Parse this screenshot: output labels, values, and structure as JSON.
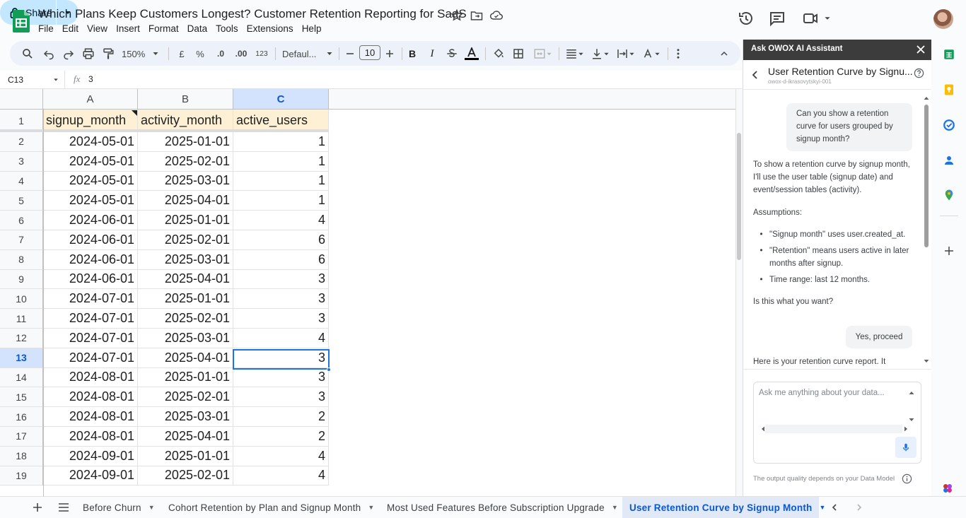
{
  "doc": {
    "title": "Which Plans Keep Customers Longest? Customer Retention Reporting for SaaS"
  },
  "menu": [
    "File",
    "Edit",
    "View",
    "Insert",
    "Format",
    "Data",
    "Tools",
    "Extensions",
    "Help"
  ],
  "share": {
    "label": "Share"
  },
  "toolbar": {
    "zoom": "150%",
    "currency": "£",
    "percent": "%",
    "decrease_decimals": ".0",
    "increase_decimals": ".00",
    "number_format": "123",
    "font": "Defaul...",
    "font_size": "10",
    "bold": "B",
    "italic": "I"
  },
  "formula_bar": {
    "cell_ref": "C13",
    "fx": "fx",
    "value": "3"
  },
  "grid": {
    "columns": [
      "A",
      "B",
      "C"
    ],
    "header_row": {
      "num": "1",
      "cells": [
        "signup_month",
        "activity_month",
        "active_users"
      ]
    },
    "rows": [
      {
        "num": "2",
        "cells": [
          "2024-05-01",
          "2025-01-01",
          "1"
        ]
      },
      {
        "num": "3",
        "cells": [
          "2024-05-01",
          "2025-02-01",
          "1"
        ]
      },
      {
        "num": "4",
        "cells": [
          "2024-05-01",
          "2025-03-01",
          "1"
        ]
      },
      {
        "num": "5",
        "cells": [
          "2024-05-01",
          "2025-04-01",
          "1"
        ]
      },
      {
        "num": "6",
        "cells": [
          "2024-06-01",
          "2025-01-01",
          "4"
        ]
      },
      {
        "num": "7",
        "cells": [
          "2024-06-01",
          "2025-02-01",
          "6"
        ]
      },
      {
        "num": "8",
        "cells": [
          "2024-06-01",
          "2025-03-01",
          "6"
        ]
      },
      {
        "num": "9",
        "cells": [
          "2024-06-01",
          "2025-04-01",
          "3"
        ]
      },
      {
        "num": "10",
        "cells": [
          "2024-07-01",
          "2025-01-01",
          "3"
        ]
      },
      {
        "num": "11",
        "cells": [
          "2024-07-01",
          "2025-02-01",
          "3"
        ]
      },
      {
        "num": "12",
        "cells": [
          "2024-07-01",
          "2025-03-01",
          "4"
        ]
      },
      {
        "num": "13",
        "cells": [
          "2024-07-01",
          "2025-04-01",
          "3"
        ]
      },
      {
        "num": "14",
        "cells": [
          "2024-08-01",
          "2025-01-01",
          "3"
        ]
      },
      {
        "num": "15",
        "cells": [
          "2024-08-01",
          "2025-02-01",
          "3"
        ]
      },
      {
        "num": "16",
        "cells": [
          "2024-08-01",
          "2025-03-01",
          "2"
        ]
      },
      {
        "num": "17",
        "cells": [
          "2024-08-01",
          "2025-04-01",
          "2"
        ]
      },
      {
        "num": "18",
        "cells": [
          "2024-09-01",
          "2025-01-01",
          "4"
        ]
      },
      {
        "num": "19",
        "cells": [
          "2024-09-01",
          "2025-02-01",
          "4"
        ]
      }
    ]
  },
  "assistant": {
    "panel_title": "Ask OWOX AI Assistant",
    "report_title": "User Retention Curve by Signu...",
    "report_subtitle": "owox-d-ikrasovytskyi-001",
    "user_message_1": "Can you show a retention curve for users grouped by signup month?",
    "reply_intro": "To show a retention curve by signup month, I'll use the user table (signup date) and event/session tables (activity).",
    "assumptions_heading": "Assumptions:",
    "assumptions": [
      "\"Signup month\" uses user.created_at.",
      "\"Retention\" means users active in later months after signup.",
      "Time range: last 12 months."
    ],
    "question": "Is this what you want?",
    "user_message_2": "Yes, proceed",
    "reply_partial": "Here is your retention curve report. It",
    "input_placeholder": "Ask me anything about your data...",
    "footer_note": "The output quality depends on your Data Model"
  },
  "tabs": [
    {
      "label": "Before Churn",
      "active": false
    },
    {
      "label": "Cohort Retention by Plan and Signup Month",
      "active": false
    },
    {
      "label": "Most Used Features Before Subscription Upgrade",
      "active": false
    },
    {
      "label": "User Retention Curve by Signup Month",
      "active": true
    }
  ],
  "colors": {
    "accent": "#0b57d0",
    "share_bg": "#c2e7ff",
    "header_cell_bg": "#fdf0d5",
    "selected_col_bg": "#d3e3fd"
  }
}
